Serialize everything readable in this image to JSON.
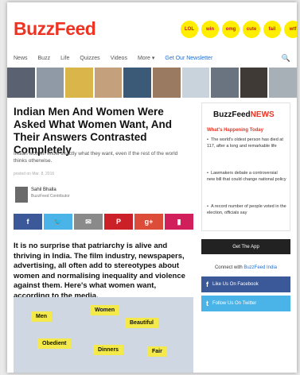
{
  "header": {
    "logo": "BuzzFeed",
    "badges": [
      "LOL",
      "win",
      "omg",
      "cute",
      "fail",
      "wtf",
      "✓"
    ],
    "nav": [
      "News",
      "Buzz",
      "Life",
      "Quizzes",
      "Videos",
      "More ▾"
    ],
    "signup": "Get Our Newsletter",
    "search_icon": "🔍"
  },
  "strip_colors": [
    "#5a6272",
    "#8f9aa6",
    "#d9b54a",
    "#c5a07c",
    "#3a5a78",
    "#9a7b62",
    "#c9d3dc",
    "#6a7480",
    "#3f3a36",
    "#a8b0b7"
  ],
  "article": {
    "title": "Indian Men And Women Were Asked What Women Want, And Their Answers Contrasted Completely",
    "dek": "Indian women know exactly what they want, even if the rest of the world thinks otherwise.",
    "meta": "posted on Mar. 8, 2016",
    "author_name": "Sahil Bhalla",
    "author_role": "BuzzFeed Contributor",
    "share": [
      {
        "icon": "f",
        "color": "#3b5998"
      },
      {
        "icon": "🐦",
        "color": "#4ab3e8"
      },
      {
        "icon": "✉",
        "color": "#8a8a8a"
      },
      {
        "icon": "P",
        "color": "#cb2027"
      },
      {
        "icon": "g+",
        "color": "#dd4b39"
      },
      {
        "icon": "▮",
        "color": "#d01f5a"
      }
    ],
    "body": "It is no surprise that patriarchy is alive and thriving in India. The film industry, newspapers, advertising, all often add to stereotypes about women and normalising inequality and violence against them. Here's what women want, according to the media.",
    "photo_tags": [
      "Men",
      "Women",
      "Beautiful",
      "Obedient",
      "Dinners",
      "Fair"
    ]
  },
  "sidebar": {
    "logo_main": "BuzzFeed",
    "logo_accent": "NEWS",
    "label": "What's Happening Today",
    "items": [
      "The world's oldest person has died at 117, after a long and remarkable life",
      "Lawmakers debate a controversial new bill that could change national policy",
      "A record number of people voted in the election, officials say"
    ],
    "cta": "Get The App",
    "connect_prefix": "Connect with",
    "connect_link": "BuzzFeed India",
    "facebook": "Like Us On Facebook",
    "twitter": "Follow Us On Twitter"
  }
}
